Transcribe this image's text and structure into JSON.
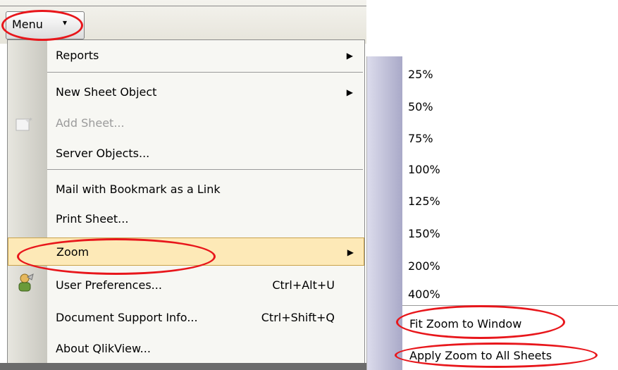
{
  "toolbar": {
    "menu_label": "Menu",
    "menu_arrow": "▾"
  },
  "main_menu": {
    "items": [
      {
        "label": "Reports",
        "submenu": true,
        "disabled": false
      },
      {
        "label": "New Sheet Object",
        "submenu": true,
        "disabled": false
      },
      {
        "label": "Add Sheet...",
        "submenu": false,
        "disabled": true,
        "icon": "add-sheet-icon"
      },
      {
        "label": "Server Objects...",
        "submenu": false,
        "disabled": false
      },
      {
        "label": "Mail with Bookmark as a Link",
        "submenu": false,
        "disabled": false
      },
      {
        "label": "Print Sheet...",
        "submenu": false,
        "disabled": false
      },
      {
        "label": "Zoom",
        "submenu": true,
        "disabled": false,
        "highlighted": true
      },
      {
        "label": "User Preferences...",
        "shortcut": "Ctrl+Alt+U",
        "icon": "user-preferences-icon"
      },
      {
        "label": "Document Support Info...",
        "shortcut": "Ctrl+Shift+Q"
      },
      {
        "label": "About QlikView..."
      }
    ],
    "submenu_arrow": "▶"
  },
  "zoom_menu": {
    "levels": [
      "25%",
      "50%",
      "75%",
      "100%",
      "125%",
      "150%",
      "200%",
      "400%"
    ],
    "fit_label": "Fit Zoom to Window",
    "apply_label": "Apply Zoom to All Sheets"
  },
  "colors": {
    "annotation_red": "#e8161b",
    "highlight_bg": "#fde9b7",
    "disabled_text": "#9b9b9b"
  }
}
